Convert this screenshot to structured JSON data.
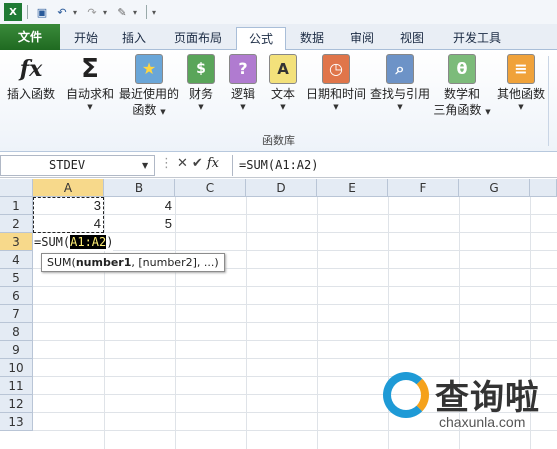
{
  "quick_access": {
    "icons": [
      "excel-icon",
      "save-icon",
      "undo-icon",
      "redo-icon",
      "customize-icon"
    ]
  },
  "tabs": [
    {
      "label": "文件"
    },
    {
      "label": "开始"
    },
    {
      "label": "插入"
    },
    {
      "label": "页面布局"
    },
    {
      "label": "公式"
    },
    {
      "label": "数据"
    },
    {
      "label": "审阅"
    },
    {
      "label": "视图"
    },
    {
      "label": "开发工具"
    }
  ],
  "active_tab": "公式",
  "ribbon": {
    "group_label": "函数库",
    "buttons": [
      {
        "line1": "插入函数",
        "line2": "",
        "icon_glyph": "fx",
        "icon": "insert-function-icon",
        "has_arrow": false
      },
      {
        "line1": "自动求和",
        "line2": "",
        "icon_glyph": "Σ",
        "icon": "autosum-icon",
        "has_arrow": true
      },
      {
        "line1": "最近使用的",
        "line2": "函数",
        "icon_glyph": "★",
        "icon": "recent-functions-icon",
        "has_arrow": true
      },
      {
        "line1": "财务",
        "line2": "",
        "icon_glyph": "$",
        "icon": "financial-icon",
        "has_arrow": true
      },
      {
        "line1": "逻辑",
        "line2": "",
        "icon_glyph": "?",
        "icon": "logical-icon",
        "has_arrow": true
      },
      {
        "line1": "文本",
        "line2": "",
        "icon_glyph": "A",
        "icon": "text-icon",
        "has_arrow": true
      },
      {
        "line1": "日期和时间",
        "line2": "",
        "icon_glyph": "◷",
        "icon": "date-time-icon",
        "has_arrow": true
      },
      {
        "line1": "查找与引用",
        "line2": "",
        "icon_glyph": "⌕",
        "icon": "lookup-reference-icon",
        "has_arrow": true
      },
      {
        "line1": "数学和",
        "line2": "三角函数",
        "icon_glyph": "θ",
        "icon": "math-trig-icon",
        "has_arrow": true
      },
      {
        "line1": "其他函数",
        "line2": "",
        "icon_glyph": "≡",
        "icon": "more-functions-icon",
        "has_arrow": true
      }
    ]
  },
  "formula_bar": {
    "name_box": "STDEV",
    "fx_label": "fx",
    "formula": "=SUM(A1:A2)"
  },
  "columns": [
    "A",
    "B",
    "C",
    "D",
    "E",
    "F",
    "G"
  ],
  "rows": [
    "1",
    "2",
    "3",
    "4",
    "5",
    "6",
    "7",
    "8",
    "9",
    "10",
    "11",
    "12",
    "13"
  ],
  "cells": {
    "A1": "3",
    "B1": "4",
    "A2": "4",
    "B2": "5"
  },
  "edit_cell": {
    "prefix": "=SUM(",
    "highlight": "A1:A2",
    "suffix": ")"
  },
  "tooltip": {
    "fn": "SUM(",
    "bold_arg": "number1",
    "rest": ", [number2], ...)"
  },
  "watermark": {
    "text": "查询啦",
    "url": "chaxunla.com"
  }
}
